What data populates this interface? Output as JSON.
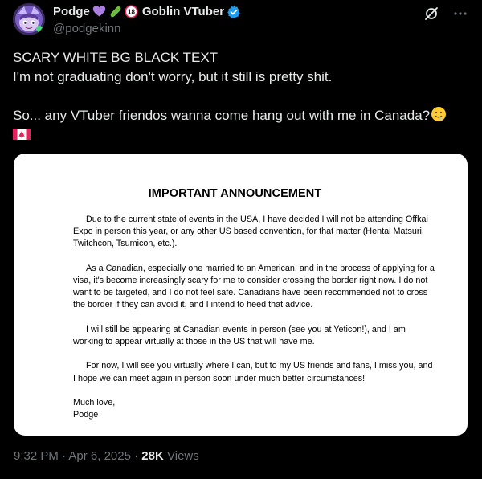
{
  "author": {
    "display_name": "Podge",
    "name_suffix": "Goblin VTuber",
    "handle": "@podgekinn",
    "verified": true
  },
  "icons": {
    "emojis_in_name": [
      "purple-heart-icon",
      "cucumber-icon",
      "no-under-18-icon"
    ],
    "verified": "verified-badge-icon",
    "grok": "grok-icon",
    "more": "more-icon",
    "text_emoji": "slightly-smiling-drooling-face-icon",
    "flag": "canada-flag-icon"
  },
  "tweet": {
    "line1": "SCARY WHITE BG BLACK TEXT",
    "line2": "I'm not graduating don't worry, but it still is pretty shit.",
    "line3": "So... any VTuber friendos wanna come hang out with me in Canada?"
  },
  "card": {
    "title": "IMPORTANT ANNOUNCEMENT",
    "paragraphs": [
      "Due to the current state of events in the USA, I have decided I will not be attending Offkai Expo in person this year, or any other US based convention, for that matter (Hentai Matsuri, Twitchcon, Tsumicon, etc.).",
      "As a Canadian, especially one married to an American, and in the process of applying for a visa, it's become increasingly scary for me to consider crossing the border right now. I do not want to be targeted, and I do not feel safe. Canadians have been recommended not to cross the border if they can avoid it, and I intend to heed that advice.",
      "I will still be appearing at Canadian events in person (see you at Yeticon!), and I am working to appear virtually at those in the US that will have me.",
      "For now, I will see you virtually where I can, but to my US friends and fans, I miss you, and I hope we can meet again in person soon under much better circumstances!"
    ],
    "signoff": "Much love,",
    "signature": "Podge"
  },
  "meta": {
    "time": "9:32 PM",
    "separator": "·",
    "date": "Apr 6, 2025",
    "views_count": "28K",
    "views_label": "Views"
  },
  "colors": {
    "background": "#000000",
    "text": "#e7e9ea",
    "muted": "#71767b",
    "verified": "#1d9bf0"
  }
}
